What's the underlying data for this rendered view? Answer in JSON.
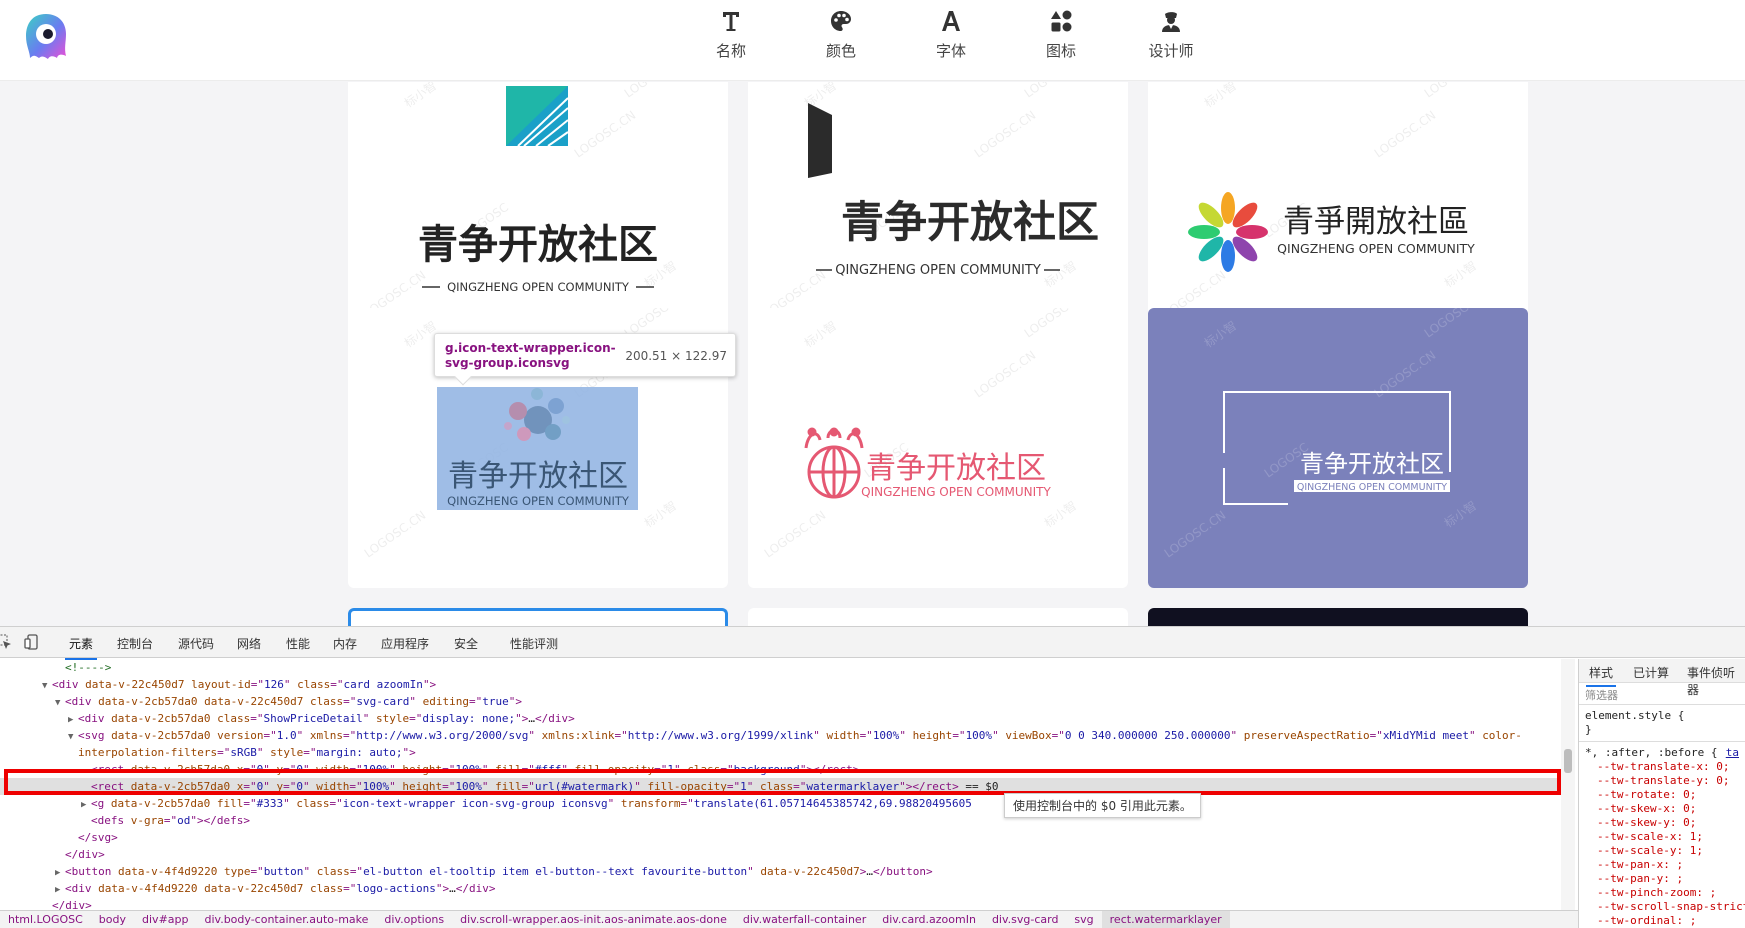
{
  "nav": [
    {
      "label": "名称",
      "icon": "text-t-icon"
    },
    {
      "label": "颜色",
      "icon": "palette-icon"
    },
    {
      "label": "字体",
      "icon": "font-a-icon"
    },
    {
      "label": "图标",
      "icon": "shapes-icon"
    },
    {
      "label": "设计师",
      "icon": "designer-icon"
    }
  ],
  "watermark": [
    "标小智",
    "LOGOSC.CN",
    "LOGOSC"
  ],
  "cards": [
    {
      "name": "青争开放社区",
      "sub": "QINGZHENG OPEN COMMUNITY"
    },
    {
      "name": "青争开放社区",
      "sub": "QINGZHENG OPEN COMMUNITY"
    },
    {
      "name": "青爭開放社區",
      "sub": "QINGZHENG OPEN COMMUNITY"
    },
    {
      "name": "青争开放社区",
      "sub": "QINGZHENG OPEN COMMUNITY"
    },
    {
      "name": "青争开放社区",
      "sub": "QINGZHENG OPEN COMMUNITY"
    },
    {
      "name": "青争开放社区",
      "sub": "QINGZHENG OPEN COMMUNITY"
    }
  ],
  "inspect_tooltip": {
    "selector": "g.icon-text-wrapper.icon-svg-group.iconsvg",
    "size": "200.51 × 122.97"
  },
  "devtools": {
    "tabs": [
      "元素",
      "控制台",
      "源代码",
      "网络",
      "性能",
      "内存",
      "应用程序",
      "安全",
      "性能评测"
    ],
    "lines": [
      {
        "indent": 5,
        "tri": "",
        "parts": [
          [
            "cm",
            "<!---->"
          ]
        ]
      },
      {
        "indent": 4,
        "tri": "▼",
        "parts": [
          [
            "tag",
            "<div "
          ],
          [
            "attr",
            "data-v-22c450d7 layout-id"
          ],
          [
            "tag",
            "=\""
          ],
          [
            "val",
            "126"
          ],
          [
            "tag",
            "\" "
          ],
          [
            "attr",
            "class"
          ],
          [
            "tag",
            "=\""
          ],
          [
            "val",
            "card azoomIn"
          ],
          [
            "tag",
            "\">"
          ]
        ]
      },
      {
        "indent": 5,
        "tri": "▼",
        "parts": [
          [
            "tag",
            "<div "
          ],
          [
            "attr",
            "data-v-2cb57da0 data-v-22c450d7 class"
          ],
          [
            "tag",
            "=\""
          ],
          [
            "val",
            "svg-card"
          ],
          [
            "tag",
            "\" "
          ],
          [
            "attr",
            "editing"
          ],
          [
            "tag",
            "=\""
          ],
          [
            "val",
            "true"
          ],
          [
            "tag",
            "\">"
          ]
        ]
      },
      {
        "indent": 6,
        "tri": "▶",
        "parts": [
          [
            "tag",
            "<div "
          ],
          [
            "attr",
            "data-v-2cb57da0 class"
          ],
          [
            "tag",
            "=\""
          ],
          [
            "val",
            "ShowPriceDetail"
          ],
          [
            "tag",
            "\" "
          ],
          [
            "attr",
            "style"
          ],
          [
            "tag",
            "=\""
          ],
          [
            "val",
            "display: none;"
          ],
          [
            "tag",
            "\">"
          ],
          [
            "txt",
            "…"
          ],
          [
            "tag",
            "</div>"
          ]
        ]
      },
      {
        "indent": 6,
        "tri": "▼",
        "parts": [
          [
            "tag",
            "<svg "
          ],
          [
            "attr",
            "data-v-2cb57da0 version"
          ],
          [
            "tag",
            "=\""
          ],
          [
            "val",
            "1.0"
          ],
          [
            "tag",
            "\" "
          ],
          [
            "attr",
            "xmlns"
          ],
          [
            "tag",
            "=\""
          ],
          [
            "val",
            "http://www.w3.org/2000/svg"
          ],
          [
            "tag",
            "\" "
          ],
          [
            "attr",
            "xmlns:xlink"
          ],
          [
            "tag",
            "=\""
          ],
          [
            "val",
            "http://www.w3.org/1999/xlink"
          ],
          [
            "tag",
            "\" "
          ],
          [
            "attr",
            "width"
          ],
          [
            "tag",
            "=\""
          ],
          [
            "val",
            "100%"
          ],
          [
            "tag",
            "\" "
          ],
          [
            "attr",
            "height"
          ],
          [
            "tag",
            "=\""
          ],
          [
            "val",
            "100%"
          ],
          [
            "tag",
            "\" "
          ],
          [
            "attr",
            "viewBox"
          ],
          [
            "tag",
            "=\""
          ],
          [
            "val",
            "0 0 340.000000 250.000000"
          ],
          [
            "tag",
            "\" "
          ],
          [
            "attr",
            "preserveAspectRatio"
          ],
          [
            "tag",
            "=\""
          ],
          [
            "val",
            "xMidYMid meet"
          ],
          [
            "tag",
            "\" "
          ],
          [
            "attr",
            "color-"
          ]
        ]
      },
      {
        "indent": 6,
        "tri": "",
        "parts": [
          [
            "attr",
            "interpolation-filters"
          ],
          [
            "tag",
            "=\""
          ],
          [
            "val",
            "sRGB"
          ],
          [
            "tag",
            "\" "
          ],
          [
            "attr",
            "style"
          ],
          [
            "tag",
            "=\""
          ],
          [
            "val",
            "margin: auto;"
          ],
          [
            "tag",
            "\">"
          ]
        ]
      },
      {
        "indent": 7,
        "tri": "",
        "parts": [
          [
            "tag",
            "<rect "
          ],
          [
            "attr",
            "data-v-2cb57da0 x"
          ],
          [
            "tag",
            "=\""
          ],
          [
            "val",
            "0"
          ],
          [
            "tag",
            "\" "
          ],
          [
            "attr",
            "y"
          ],
          [
            "tag",
            "=\""
          ],
          [
            "val",
            "0"
          ],
          [
            "tag",
            "\" "
          ],
          [
            "attr",
            "width"
          ],
          [
            "tag",
            "=\""
          ],
          [
            "val",
            "100%"
          ],
          [
            "tag",
            "\" "
          ],
          [
            "attr",
            "height"
          ],
          [
            "tag",
            "=\""
          ],
          [
            "val",
            "100%"
          ],
          [
            "tag",
            "\" "
          ],
          [
            "attr",
            "fill"
          ],
          [
            "tag",
            "=\""
          ],
          [
            "val",
            "#fff"
          ],
          [
            "tag",
            "\" "
          ],
          [
            "attr",
            "fill-opacity"
          ],
          [
            "tag",
            "=\""
          ],
          [
            "val",
            "1"
          ],
          [
            "tag",
            "\" "
          ],
          [
            "attr",
            "class"
          ],
          [
            "tag",
            "=\""
          ],
          [
            "val",
            "background"
          ],
          [
            "tag",
            "\"></rect>"
          ]
        ]
      },
      {
        "indent": 7,
        "tri": "",
        "hl": true,
        "parts": [
          [
            "tag",
            "<rect "
          ],
          [
            "attr",
            "data-v-2cb57da0 x"
          ],
          [
            "tag",
            "=\""
          ],
          [
            "val",
            "0"
          ],
          [
            "tag",
            "\" "
          ],
          [
            "attr",
            "y"
          ],
          [
            "tag",
            "=\""
          ],
          [
            "val",
            "0"
          ],
          [
            "tag",
            "\" "
          ],
          [
            "attr",
            "width"
          ],
          [
            "tag",
            "=\""
          ],
          [
            "val",
            "100%"
          ],
          [
            "tag",
            "\" "
          ],
          [
            "attr",
            "height"
          ],
          [
            "tag",
            "=\""
          ],
          [
            "val",
            "100%"
          ],
          [
            "tag",
            "\" "
          ],
          [
            "attr",
            "fill"
          ],
          [
            "tag",
            "=\""
          ],
          [
            "val",
            "url(#watermark)"
          ],
          [
            "tag",
            "\" "
          ],
          [
            "attr",
            "fill-opacity"
          ],
          [
            "tag",
            "=\""
          ],
          [
            "val",
            "1"
          ],
          [
            "tag",
            "\" "
          ],
          [
            "attr",
            "class"
          ],
          [
            "tag",
            "=\""
          ],
          [
            "val",
            "watermarklayer"
          ],
          [
            "tag",
            "\"></rect>"
          ],
          [
            "txt",
            " == $0"
          ]
        ]
      },
      {
        "indent": 7,
        "tri": "▶",
        "parts": [
          [
            "tag",
            "<g "
          ],
          [
            "attr",
            "data-v-2cb57da0 fill"
          ],
          [
            "tag",
            "=\""
          ],
          [
            "val",
            "#333"
          ],
          [
            "tag",
            "\" "
          ],
          [
            "attr",
            "class"
          ],
          [
            "tag",
            "=\""
          ],
          [
            "val",
            "icon-text-wrapper icon-svg-group iconsvg"
          ],
          [
            "tag",
            "\" "
          ],
          [
            "attr",
            "transform"
          ],
          [
            "tag",
            "=\""
          ],
          [
            "val",
            "translate(61.05714645385742,69.98820495605"
          ]
        ]
      },
      {
        "indent": 7,
        "tri": "",
        "parts": [
          [
            "tag",
            "<defs "
          ],
          [
            "attr",
            "v-gra"
          ],
          [
            "tag",
            "=\""
          ],
          [
            "val",
            "od"
          ],
          [
            "tag",
            "\"></defs>"
          ]
        ]
      },
      {
        "indent": 6,
        "tri": "",
        "parts": [
          [
            "tag",
            "</svg>"
          ]
        ]
      },
      {
        "indent": 5,
        "tri": "",
        "parts": [
          [
            "tag",
            "</div>"
          ]
        ]
      },
      {
        "indent": 5,
        "tri": "▶",
        "parts": [
          [
            "tag",
            "<button "
          ],
          [
            "attr",
            "data-v-4f4d9220 type"
          ],
          [
            "tag",
            "=\""
          ],
          [
            "val",
            "button"
          ],
          [
            "tag",
            "\" "
          ],
          [
            "attr",
            "class"
          ],
          [
            "tag",
            "=\""
          ],
          [
            "val",
            "el-button el-tooltip item el-button--text favourite-button"
          ],
          [
            "tag",
            "\" "
          ],
          [
            "attr",
            "data-v-22c450d7"
          ],
          [
            "tag",
            ">"
          ],
          [
            "txt",
            "…"
          ],
          [
            "tag",
            "</button>"
          ]
        ]
      },
      {
        "indent": 5,
        "tri": "▶",
        "parts": [
          [
            "tag",
            "<div "
          ],
          [
            "attr",
            "data-v-4f4d9220 data-v-22c450d7 class"
          ],
          [
            "tag",
            "=\""
          ],
          [
            "val",
            "logo-actions"
          ],
          [
            "tag",
            "\">"
          ],
          [
            "txt",
            "…"
          ],
          [
            "tag",
            "</div>"
          ]
        ]
      },
      {
        "indent": 4,
        "tri": "",
        "parts": [
          [
            "tag",
            "</div>"
          ]
        ]
      }
    ],
    "console_tip": "使用控制台中的 $0 引用此元素。",
    "styles_tabs": [
      "样式",
      "已计算",
      "事件侦听器"
    ],
    "filter_placeholder": "筛选器",
    "styles_rules": [
      "element.style {",
      "}",
      "*, :after, :before {",
      "--tw-translate-x: 0;",
      "--tw-translate-y: 0;",
      "--tw-rotate: 0;",
      "--tw-skew-x: 0;",
      "--tw-skew-y: 0;",
      "--tw-scale-x: 1;",
      "--tw-scale-y: 1;",
      "--tw-pan-x: ;",
      "--tw-pan-y: ;",
      "--tw-pinch-zoom: ;",
      "--tw-scroll-snap-strictness",
      "--tw-ordinal: ;"
    ],
    "styles_link": "ta",
    "breadcrumbs": [
      "html.LOGOSC",
      "body",
      "div#app",
      "div.body-container.auto-make",
      "div.options",
      "div.scroll-wrapper.aos-init.aos-animate.aos-done",
      "div.waterfall-container",
      "div.card.azoomIn",
      "div.svg-card",
      "svg",
      "rect.watermarklayer"
    ]
  },
  "colors": {
    "accent": "#1a73e8",
    "highlight": "#e00000",
    "purple_card": "#7b81bb"
  }
}
